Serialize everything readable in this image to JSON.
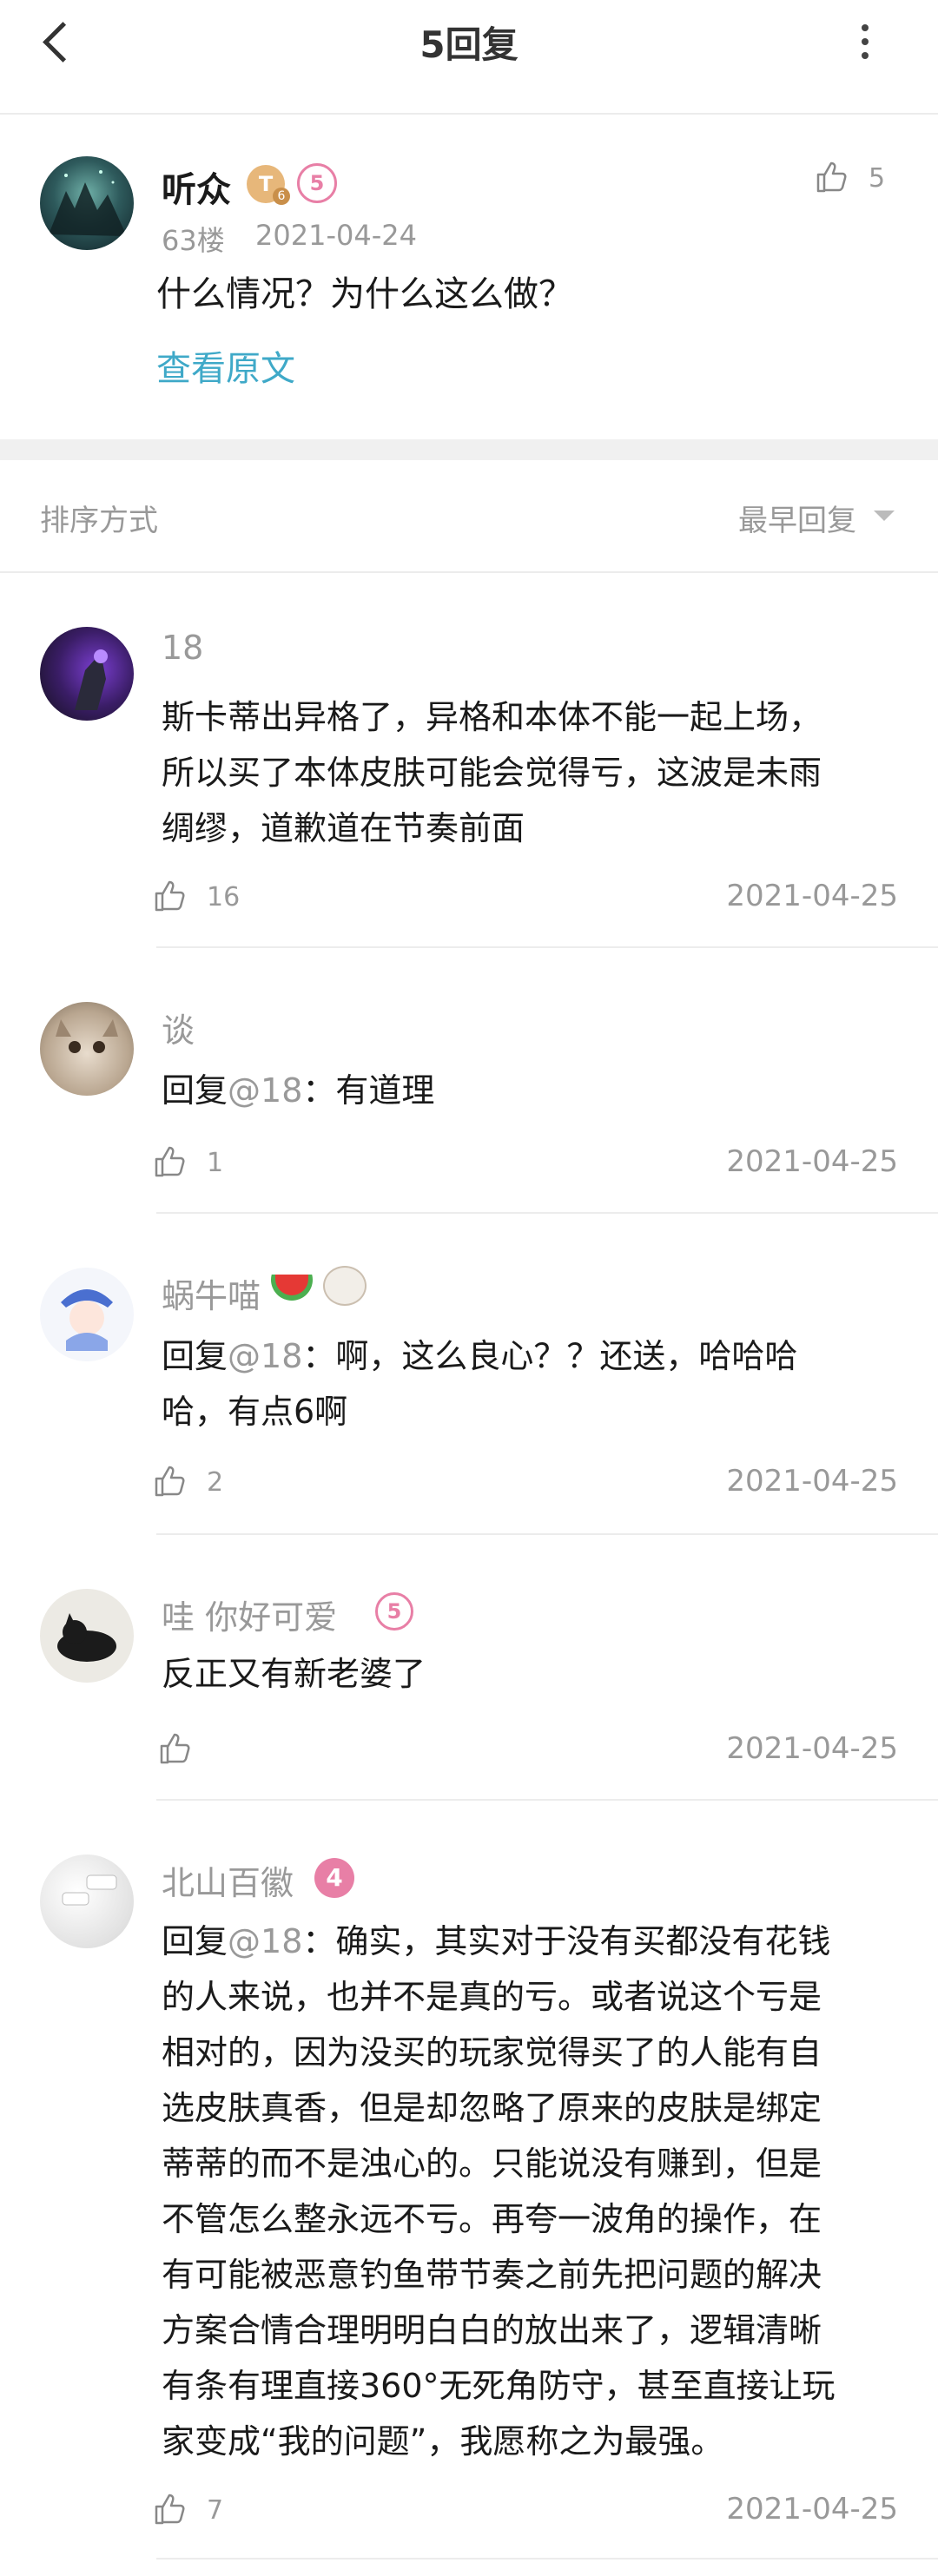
{
  "header": {
    "title": "5回复"
  },
  "op": {
    "username": "听众",
    "badge_level": "T",
    "badge_sub": "6",
    "badge_vip": "5",
    "floor": "63楼",
    "date": "2021-04-24",
    "text": "什么情况？为什么这么做？",
    "view_original": "查看原文",
    "likes": "5"
  },
  "sort": {
    "label": "排序方式",
    "value": "最早回复"
  },
  "replies": [
    {
      "username": "18",
      "lines": [
        "斯卡蒂出异格了，异格和本体不能一起上场，",
        "所以买了本体皮肤可能会觉得亏，这波是未雨",
        "绸缪，道歉道在节奏前面"
      ],
      "likes": "16",
      "date": "2021-04-25"
    },
    {
      "username": "谈",
      "prefix": "回复",
      "mention": "@18",
      "lines": [
        "：有道理"
      ],
      "likes": "1",
      "date": "2021-04-25"
    },
    {
      "username": "蜗牛喵",
      "prefix": "回复",
      "mention": "@18",
      "lines": [
        "：啊，这么良心？？还送，哈哈哈",
        "哈，有点6啊"
      ],
      "likes": "2",
      "date": "2021-04-25"
    },
    {
      "username": "哇 你好可爱",
      "badge": "5",
      "lines": [
        "反正又有新老婆了"
      ],
      "likes": "",
      "date": "2021-04-25"
    },
    {
      "username": "北山百徽",
      "badge": "4",
      "prefix": "回复",
      "mention": "@18",
      "lines": [
        "：确实，其实对于没有买都没有花钱",
        "的人来说，也并不是真的亏。或者说这个亏是",
        "相对的，因为没买的玩家觉得买了的人能有自",
        "选皮肤真香，但是却忽略了原来的皮肤是绑定",
        "蒂蒂的而不是浊心的。只能说没有赚到，但是",
        "不管怎么整永远不亏。再夸一波角的操作，在",
        "有可能被恶意钓鱼带节奏之前先把问题的解决",
        "方案合情合理明明白白的放出来了，逻辑清晰",
        "有条有理直接360°无死角防守，甚至直接让玩",
        "家变成“我的问题”，我愿称之为最强。"
      ],
      "likes": "7",
      "date": "2021-04-25"
    }
  ],
  "colors": {
    "link": "#3fa9c8",
    "gray": "#999999",
    "vip_pink": "#e87fa6",
    "band": "#f0f0f0"
  },
  "icons": {
    "back": "chevron-left-icon",
    "more": "more-vertical-icon",
    "like": "thumbs-up-icon",
    "sort": "caret-down-icon"
  }
}
